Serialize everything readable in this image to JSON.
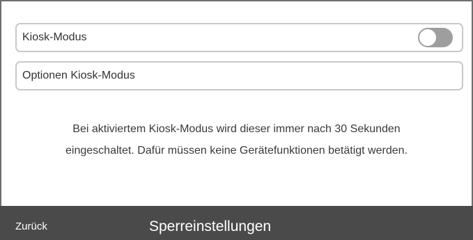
{
  "settings": {
    "kiosk_mode_label": "Kiosk-Modus",
    "kiosk_mode_enabled": false,
    "kiosk_options_label": "Optionen Kiosk-Modus"
  },
  "description": {
    "line1": "Bei aktiviertem Kiosk-Modus wird dieser immer nach 30 Sekunden",
    "line2": "eingeschaltet. Dafür  müssen keine Gerätefunktionen betätigt werden."
  },
  "footer": {
    "back_label": "Zurück",
    "title": "Sperreinstellungen"
  },
  "colors": {
    "footer_bg": "#4a4a4a",
    "toggle_off": "#9e9e9e",
    "row_border": "#c8c8c8"
  }
}
